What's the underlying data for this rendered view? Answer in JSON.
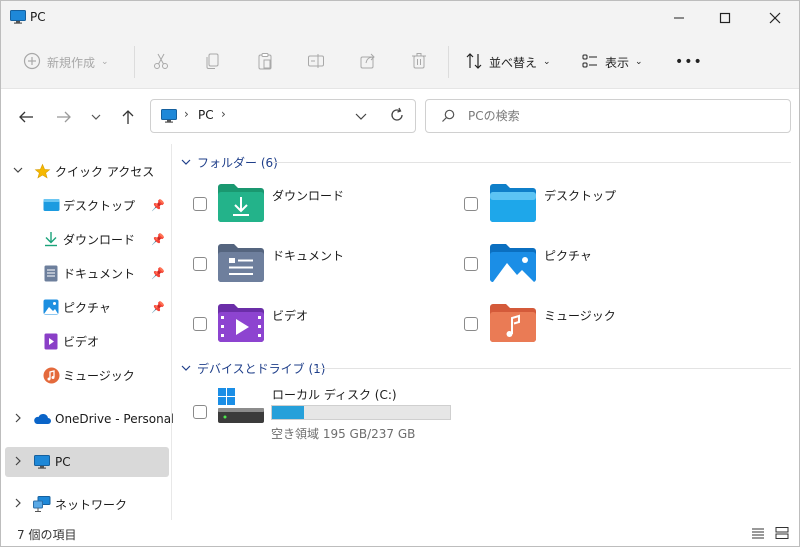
{
  "window": {
    "title": "PC"
  },
  "ribbon": {
    "new_label": "新規作成",
    "sort_label": "並べ替え",
    "view_label": "表示",
    "more": "•••"
  },
  "nav": {
    "address_item": "PC",
    "search_placeholder": "PCの検索"
  },
  "sidebar": {
    "quick_access": "クイック アクセス",
    "items": [
      {
        "label": "デスクトップ",
        "pinned": true
      },
      {
        "label": "ダウンロード",
        "pinned": true
      },
      {
        "label": "ドキュメント",
        "pinned": true
      },
      {
        "label": "ピクチャ",
        "pinned": true
      },
      {
        "label": "ビデオ"
      },
      {
        "label": "ミュージック"
      }
    ],
    "onedrive": "OneDrive - Personal",
    "pc": "PC",
    "network": "ネットワーク"
  },
  "content": {
    "folders_group": "フォルダー (6)",
    "folders": [
      {
        "name": "ダウンロード"
      },
      {
        "name": "デスクトップ"
      },
      {
        "name": "ドキュメント"
      },
      {
        "name": "ピクチャ"
      },
      {
        "name": "ビデオ"
      },
      {
        "name": "ミュージック"
      }
    ],
    "drives_group": "デバイスとドライブ (1)",
    "drive": {
      "name": "ローカル ディスク (C:)",
      "free_text": "空き領域 195 GB/237 GB",
      "used_fraction": 0.18
    }
  },
  "status": {
    "items_text": "7 個の項目"
  },
  "colors": {
    "accent": "#26a0da",
    "group_header": "#1f3f8a"
  }
}
